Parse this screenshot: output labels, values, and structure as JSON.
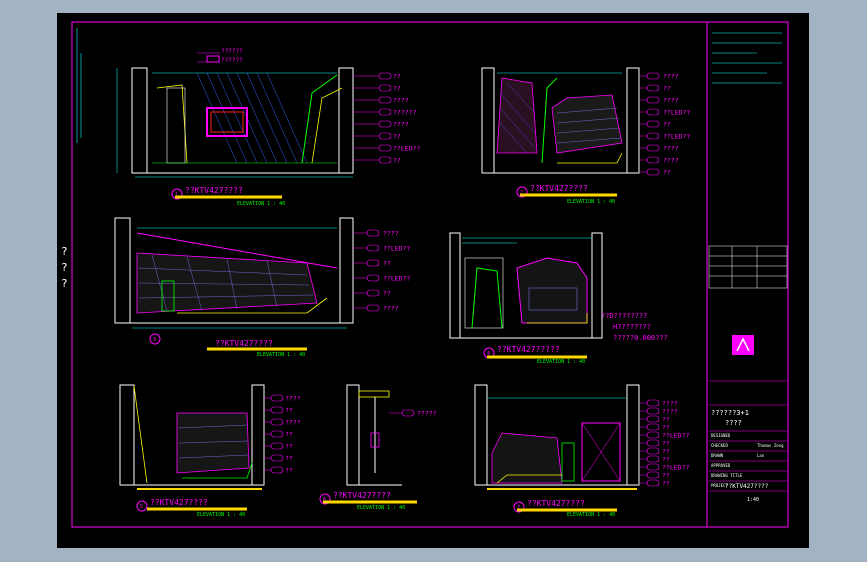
{
  "colors": {
    "background": "#a3b3c4",
    "canvas": "#000000",
    "frame": "#ff00ff",
    "wall": "#ffffff",
    "dimension": "#00ffff",
    "title_bar": "#ffd800",
    "green": "#00ff00",
    "yellow": "#ffff00",
    "red": "#ff2020",
    "blue": "#3060ff"
  },
  "margin_marks": [
    "?",
    "?",
    "?"
  ],
  "elevations": [
    {
      "title": "??KTV427????",
      "scale": "ELEVATION 1 : 40",
      "callouts": [
        "??",
        "??",
        "????",
        "??????",
        "????",
        "??",
        "??LED??",
        "??"
      ],
      "top_notes": [
        "??????",
        "??????"
      ]
    },
    {
      "title": "??KTV427????",
      "scale": "ELEVATION 1 : 40",
      "callouts": [
        "????",
        "??",
        "????",
        "??LED??",
        "??",
        "??LED??",
        "????",
        "????",
        "??"
      ]
    },
    {
      "title": "??KTV427????",
      "scale": "ELEVATION 1 : 40",
      "callouts": [
        "????",
        "??LED??",
        "??",
        "??LED??",
        "??",
        "????"
      ]
    },
    {
      "title": "??KTV427?????",
      "scale": "ELEVATION 1 : 40",
      "notes": [
        "??D????????",
        "H????????",
        "?????0.000???"
      ]
    },
    {
      "title": "??KTV427????",
      "scale": "ELEVATION 1 : 40",
      "callouts": [
        "????",
        "??",
        "????",
        "??",
        "??",
        "??",
        "??"
      ]
    },
    {
      "title": "??KTV427????",
      "scale": "ELEVATION 1 : 40",
      "callouts": [
        "?????"
      ]
    },
    {
      "title": "??KTV427????",
      "scale": "ELEVATION 1 : 40",
      "callouts": [
        "????",
        "????",
        "??",
        "??",
        "??LED??",
        "??",
        "??",
        "??",
        "??LED??",
        "??",
        "??"
      ]
    }
  ],
  "title_block": {
    "project_name": "??????3+1",
    "project_sub": "????",
    "drawing_name": "??KTV427????",
    "scale_value": "1:40",
    "labels": [
      "DESIGNED",
      "CHECKED",
      "DRAWN",
      "APPROVED",
      "DRAWING TITLE",
      "PROJECT"
    ],
    "values": [
      "",
      "Thomas Zeng",
      "Lan",
      "",
      "",
      ""
    ]
  }
}
